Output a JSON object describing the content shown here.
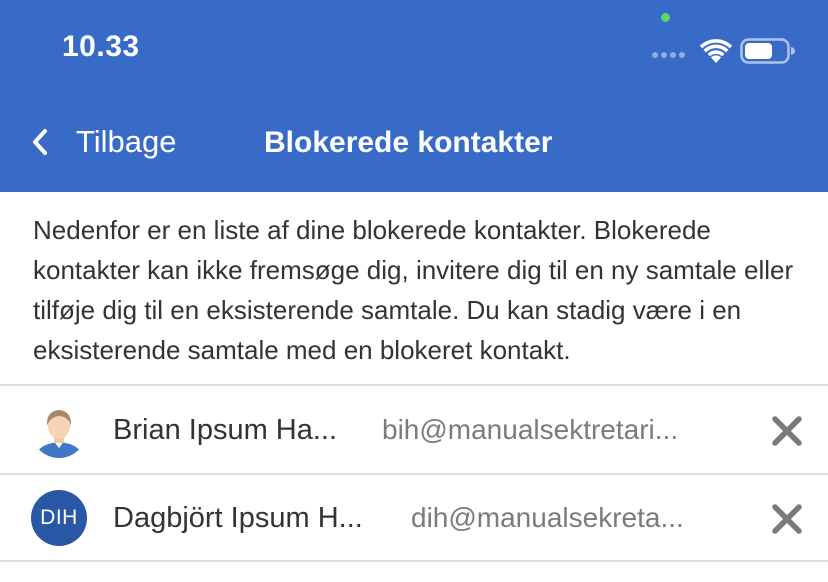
{
  "status_bar": {
    "time": "10.33"
  },
  "nav": {
    "back_label": "Tilbage",
    "title": "Blokerede kontakter"
  },
  "intro_text": "Nedenfor er en liste af dine blokerede kontakter. Blokerede kontakter kan ikke fremsøge dig, invitere dig til en ny samtale eller tilføje dig til en eksisterende samtale. Du kan stadig være i en eksisterende samtale med en blokeret kontakt.",
  "contacts": [
    {
      "name": "Brian Ipsum Ha...",
      "email": "bih@manualsektretari...",
      "avatar": "person-photo"
    },
    {
      "name": "Dagbjört Ipsum H...",
      "email": "dih@manualsekreta...",
      "initials": "DIH"
    }
  ],
  "colors": {
    "header": "#386bc8",
    "avatar_bg": "#2857a6",
    "remove_icon": "#7a7a7a"
  }
}
